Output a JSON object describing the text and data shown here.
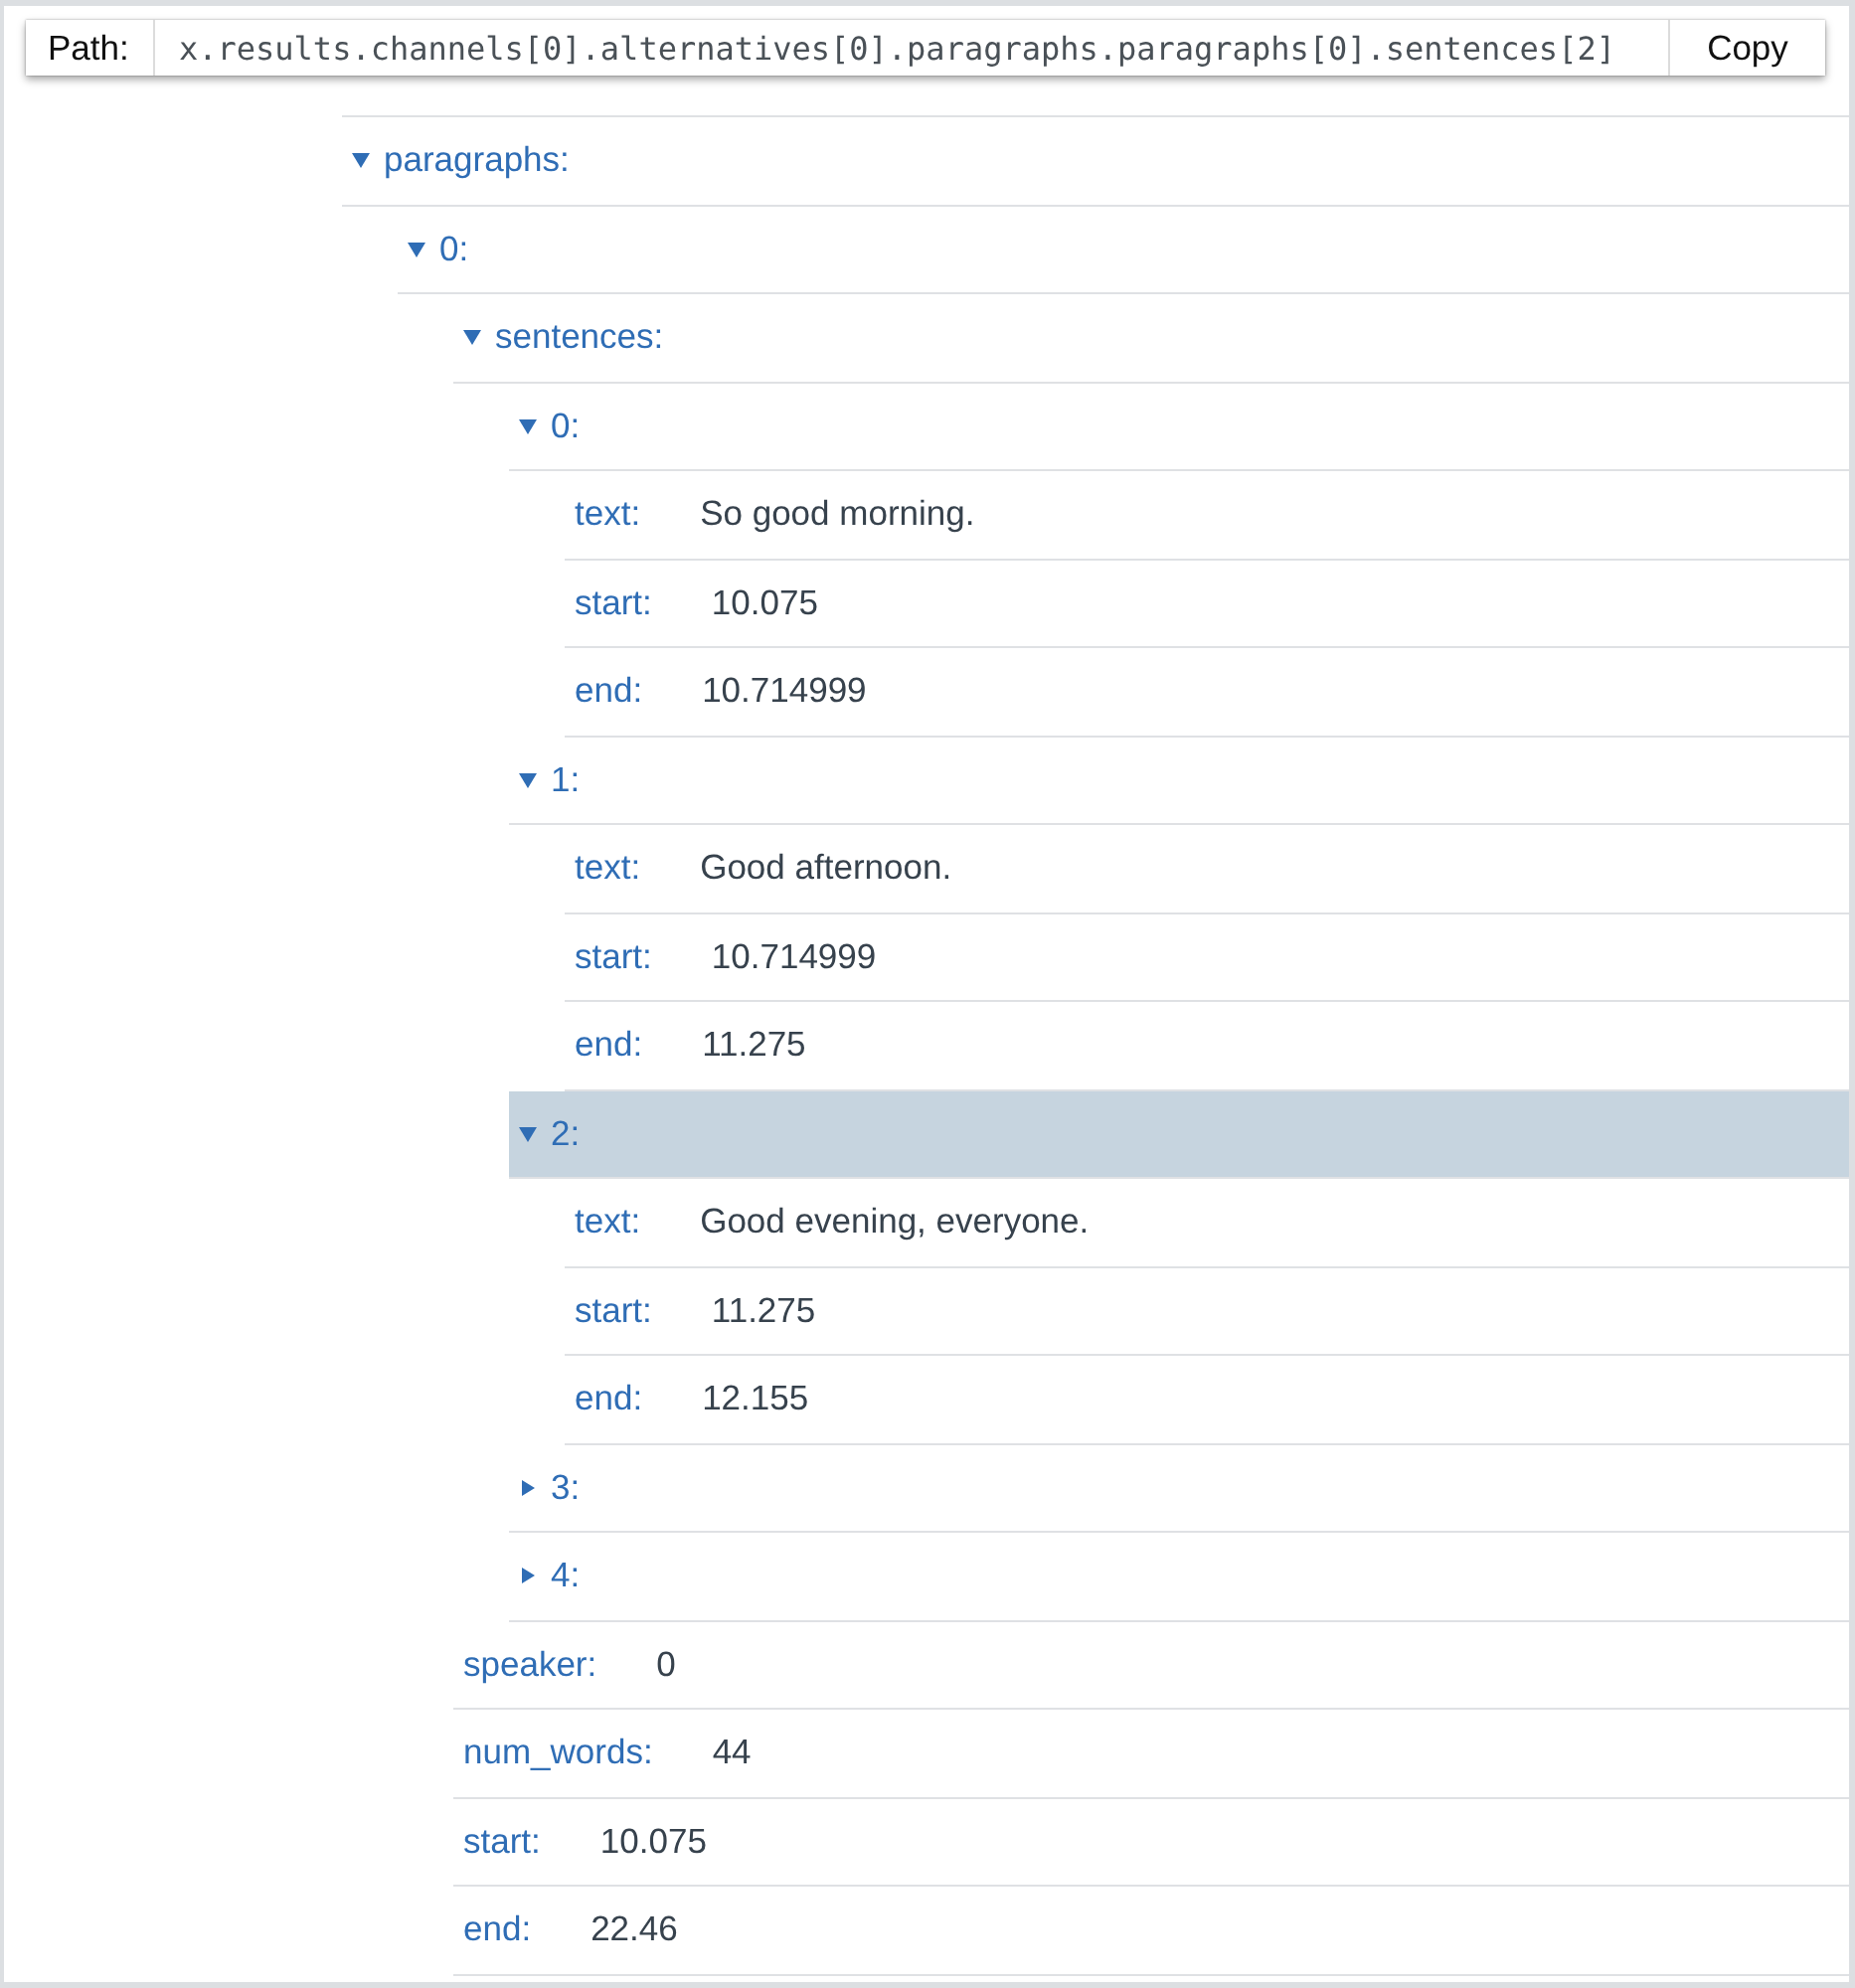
{
  "path_bar": {
    "label": "Path:",
    "path": "x.results.channels[0].alternatives[0].paragraphs.paragraphs[0].sentences[2]",
    "copy_button": "Copy"
  },
  "tree": [
    {
      "kind": "branch",
      "key": "paragraphs:",
      "expanded": true,
      "selected": false,
      "children": [
        {
          "kind": "branch",
          "key": "0:",
          "expanded": true,
          "selected": false,
          "children": [
            {
              "kind": "branch",
              "key": "sentences:",
              "expanded": true,
              "selected": false,
              "children": [
                {
                  "kind": "branch",
                  "key": "0:",
                  "expanded": true,
                  "selected": false,
                  "children": [
                    {
                      "kind": "leaf",
                      "key": "text:",
                      "value": "So good morning.",
                      "selected": false
                    },
                    {
                      "kind": "leaf",
                      "key": "start:",
                      "value": "10.075",
                      "selected": false
                    },
                    {
                      "kind": "leaf",
                      "key": "end:",
                      "value": "10.714999",
                      "selected": false
                    }
                  ]
                },
                {
                  "kind": "branch",
                  "key": "1:",
                  "expanded": true,
                  "selected": false,
                  "children": [
                    {
                      "kind": "leaf",
                      "key": "text:",
                      "value": "Good afternoon.",
                      "selected": false
                    },
                    {
                      "kind": "leaf",
                      "key": "start:",
                      "value": "10.714999",
                      "selected": false
                    },
                    {
                      "kind": "leaf",
                      "key": "end:",
                      "value": "11.275",
                      "selected": false
                    }
                  ]
                },
                {
                  "kind": "branch",
                  "key": "2:",
                  "expanded": true,
                  "selected": true,
                  "children": [
                    {
                      "kind": "leaf",
                      "key": "text:",
                      "value": "Good evening, everyone.",
                      "selected": false
                    },
                    {
                      "kind": "leaf",
                      "key": "start:",
                      "value": "11.275",
                      "selected": false
                    },
                    {
                      "kind": "leaf",
                      "key": "end:",
                      "value": "12.155",
                      "selected": false
                    }
                  ]
                },
                {
                  "kind": "branch",
                  "key": "3:",
                  "expanded": false,
                  "selected": false
                },
                {
                  "kind": "branch",
                  "key": "4:",
                  "expanded": false,
                  "selected": false
                }
              ]
            },
            {
              "kind": "leaf",
              "key": "speaker:",
              "value": "0",
              "selected": false
            },
            {
              "kind": "leaf",
              "key": "num_words:",
              "value": "44",
              "selected": false
            },
            {
              "kind": "leaf",
              "key": "start:",
              "value": "10.075",
              "selected": false
            },
            {
              "kind": "leaf",
              "key": "end:",
              "value": "22.46",
              "selected": false
            }
          ]
        }
      ]
    }
  ]
}
